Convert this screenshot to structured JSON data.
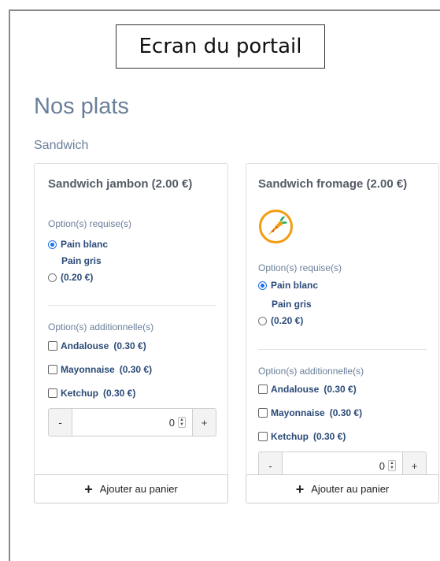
{
  "portal_label": "Ecran du portail",
  "page_title": "Nos plats",
  "category": "Sandwich",
  "products": [
    {
      "title": "Sandwich jambon (2.00 €)",
      "required_heading": "Option(s) requise(s)",
      "required_options": [
        {
          "label": "Pain blanc",
          "checked": true
        },
        {
          "label": "Pain gris",
          "price": "(0.20 €)",
          "checked": false
        }
      ],
      "additional_heading": "Option(s) additionnelle(s)",
      "additional_options": [
        {
          "name": "Andalouse",
          "price": "(0.30 €)"
        },
        {
          "name": "Mayonnaise",
          "price": "(0.30 €)"
        },
        {
          "name": "Ketchup",
          "price": "(0.30 €)"
        }
      ],
      "qty_minus": "-",
      "quantity": "0",
      "qty_plus": "+",
      "add_plus": "+",
      "add_label": "Ajouter au panier"
    },
    {
      "title": "Sandwich fromage (2.00 €)",
      "icon": "carrot-icon",
      "required_heading": "Option(s) requise(s)",
      "required_options": [
        {
          "label": "Pain blanc",
          "checked": true
        },
        {
          "label": "Pain gris",
          "price": "(0.20 €)",
          "checked": false
        }
      ],
      "additional_heading": "Option(s) additionnelle(s)",
      "additional_options": [
        {
          "name": "Andalouse",
          "price": "(0.30 €)"
        },
        {
          "name": "Mayonnaise",
          "price": "(0.30 €)"
        },
        {
          "name": "Ketchup",
          "price": "(0.30 €)"
        }
      ],
      "qty_minus": "-",
      "quantity": "0",
      "qty_plus": "+",
      "add_plus": "+",
      "add_label": "Ajouter au panier"
    }
  ],
  "colors": {
    "accent": "#1a73e8",
    "heading": "#6a7f9a",
    "option_text": "#2b4a78",
    "carrot_ring": "#f39c12"
  }
}
